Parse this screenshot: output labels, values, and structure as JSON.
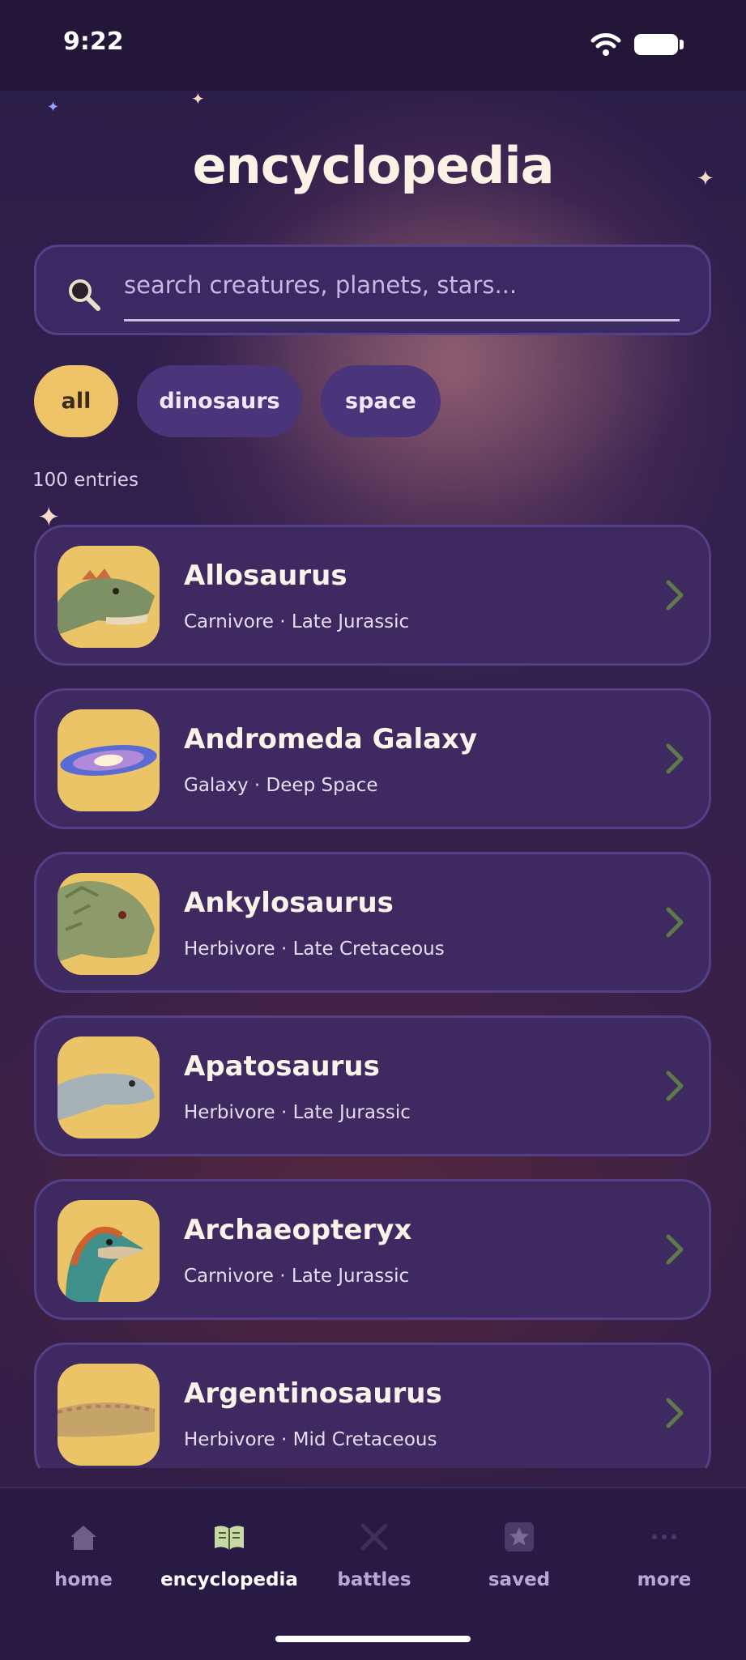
{
  "status_bar": {
    "time": "9:22"
  },
  "header": {
    "title": "encyclopedia"
  },
  "search": {
    "placeholder": "search creatures, planets, stars..."
  },
  "filters": [
    {
      "label": "all",
      "selected": true
    },
    {
      "label": "dinosaurs",
      "selected": false
    },
    {
      "label": "space",
      "selected": false
    }
  ],
  "results": {
    "count_label": "100 entries"
  },
  "entries": [
    {
      "name": "Allosaurus",
      "subtitle": "Carnivore · Late Jurassic",
      "icon": "allosaurus-head"
    },
    {
      "name": "Andromeda Galaxy",
      "subtitle": "Galaxy · Deep Space",
      "icon": "spiral-galaxy"
    },
    {
      "name": "Ankylosaurus",
      "subtitle": "Herbivore · Late Cretaceous",
      "icon": "ankylosaurus-head"
    },
    {
      "name": "Apatosaurus",
      "subtitle": "Herbivore · Late Jurassic",
      "icon": "apatosaurus-head"
    },
    {
      "name": "Archaeopteryx",
      "subtitle": "Carnivore · Late Jurassic",
      "icon": "archaeopteryx-head"
    },
    {
      "name": "Argentinosaurus",
      "subtitle": "Herbivore · Mid Cretaceous",
      "icon": "argentinosaurus-head"
    }
  ],
  "tabs": [
    {
      "label": "home",
      "icon": "house-icon",
      "active": false
    },
    {
      "label": "encyclopedia",
      "icon": "open-book-icon",
      "active": true
    },
    {
      "label": "battles",
      "icon": "crossed-swords-icon",
      "active": false
    },
    {
      "label": "saved",
      "icon": "star-badge-icon",
      "active": false
    },
    {
      "label": "more",
      "icon": "ellipsis-icon",
      "active": false
    }
  ],
  "colors": {
    "accent": "#efc367",
    "card": "#3e2a60",
    "chip": "#4a347a",
    "background": "#2a1a48",
    "chevron": "#5f7a4a"
  }
}
